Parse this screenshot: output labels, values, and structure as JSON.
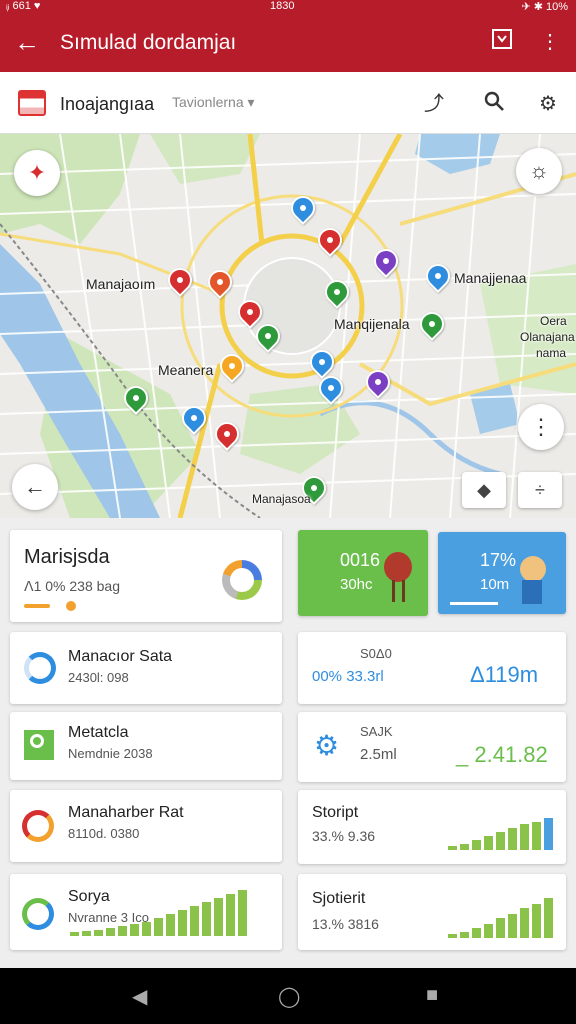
{
  "status": {
    "left": "ᵢ᷊ᵢ 661 ♥",
    "time": "1830",
    "right": "✈ ✱ 10%"
  },
  "appbar": {
    "title": "Sımulad dordamjaı"
  },
  "searchbar": {
    "name": "Inoajangıaa",
    "dropdown": "Tavionlerna"
  },
  "map": {
    "labels": [
      "Manajaoım",
      "Manajjenaa",
      "Manqijenala",
      "Meanera",
      "Manajasoa",
      "Oera",
      "Olanajana",
      "nama"
    ]
  },
  "cards": {
    "main": {
      "title": "Marisjsda",
      "subtitle": "ꓥ1 0% 238 bag"
    },
    "green": {
      "value": "0016",
      "sub": "30hc"
    },
    "blue": {
      "value": "17%",
      "sub": "10m"
    },
    "left": [
      {
        "title": "Manacıor Sata",
        "sub": "2430l: 098"
      },
      {
        "title": "Metatcla",
        "sub": "Nemdnie 2038"
      },
      {
        "title": "Manaharber Rat",
        "sub": "8110d. 0380"
      },
      {
        "title": "Sorya",
        "sub": "Nvranne 3 Ico"
      }
    ],
    "right": [
      {
        "title": "S0Δ0",
        "sub": "00% 33.3rl",
        "value": "Δ119m"
      },
      {
        "title": "SAJK",
        "sub": "2.5ml",
        "value": "_ 2.41.82"
      },
      {
        "title": "Stoript",
        "sub": "33.% 9.36"
      },
      {
        "title": "Sjotierit",
        "sub": "13.% 3816"
      }
    ]
  },
  "colors": {
    "brand": "#b71c2b",
    "green": "#6abf4b",
    "blue": "#4a9fe0"
  }
}
